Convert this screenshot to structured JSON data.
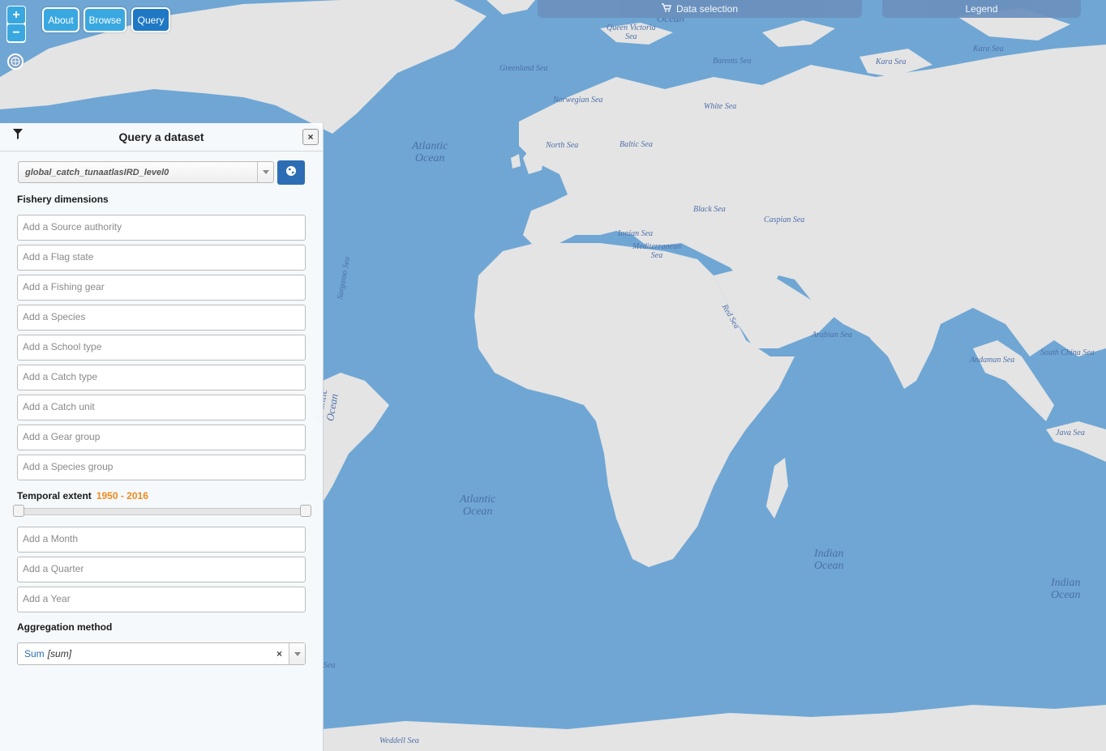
{
  "map": {
    "labels": [
      {
        "id": "ocean-top",
        "text": "Ocean"
      },
      {
        "id": "queen-victoria-sea",
        "text": "Queen Victoria\nSea"
      },
      {
        "id": "greenland-sea",
        "text": "Greenland Sea"
      },
      {
        "id": "barents-sea",
        "text": "Barents Sea"
      },
      {
        "id": "kara-sea-1",
        "text": "Kara Sea"
      },
      {
        "id": "kara-sea-2",
        "text": "Kara Sea"
      },
      {
        "id": "norwegian-sea",
        "text": "Norwegian Sea"
      },
      {
        "id": "white-sea",
        "text": "White Sea"
      },
      {
        "id": "atlantic-ocean-north",
        "text": "Atlantic\nOcean"
      },
      {
        "id": "north-sea",
        "text": "North Sea"
      },
      {
        "id": "baltic-sea",
        "text": "Baltic Sea"
      },
      {
        "id": "black-sea",
        "text": "Black Sea"
      },
      {
        "id": "caspian-sea",
        "text": "Caspian Sea"
      },
      {
        "id": "ionian-sea",
        "text": "Ionian Sea"
      },
      {
        "id": "mediterranean-sea",
        "text": "Mediterranean\nSea"
      },
      {
        "id": "sargasso-sea",
        "text": "Sargasso Sea"
      },
      {
        "id": "red-sea",
        "text": "Red Sea"
      },
      {
        "id": "arabian-sea",
        "text": "Arabian Sea"
      },
      {
        "id": "south-china-sea",
        "text": "South China Sea"
      },
      {
        "id": "andaman-sea",
        "text": "Andaman Sea"
      },
      {
        "id": "atlantic-ocean-west",
        "text": "Atlantic\nOcean"
      },
      {
        "id": "java-sea",
        "text": "Java Sea"
      },
      {
        "id": "atlantic-ocean-south",
        "text": "Atlantic\nOcean"
      },
      {
        "id": "indian-ocean-1",
        "text": "Indian\nOcean"
      },
      {
        "id": "indian-ocean-2",
        "text": "Indian\nOcean"
      },
      {
        "id": "weddell-sea",
        "text": "Weddell Sea"
      },
      {
        "id": "sea-edge",
        "text": "Sea"
      }
    ]
  },
  "controls": {
    "zoom_in": "+",
    "zoom_out": "−",
    "about": "About",
    "browse": "Browse",
    "query": "Query"
  },
  "top_tabs": {
    "data_selection": "Data selection",
    "legend": "Legend"
  },
  "panel": {
    "title": "Query a dataset",
    "close": "×",
    "dataset": "global_catch_tunaatlasIRD_level0",
    "fishery_title": "Fishery dimensions",
    "dimensions": [
      "Add a Source authority",
      "Add a Flag state",
      "Add a Fishing gear",
      "Add a Species",
      "Add a School type",
      "Add a Catch type",
      "Add a Catch unit",
      "Add a Gear group",
      "Add a Species group"
    ],
    "temporal_title": "Temporal extent",
    "temporal_range": "1950 - 2016",
    "temporal_start": 1950,
    "temporal_end": 2016,
    "temporal_dimensions": [
      "Add a Month",
      "Add a Quarter",
      "Add a Year"
    ],
    "aggregation_title": "Aggregation method",
    "aggregation_value": "Sum",
    "aggregation_code": "[sum]",
    "aggregation_clear": "×"
  },
  "colors": {
    "ocean": "#6fa6d4",
    "land": "#e4e4e4",
    "button": "#3aa8e0",
    "button_active": "#1f78c4",
    "accent": "#f08a1c"
  },
  "icons": [
    "filter-icon",
    "globe-icon",
    "caret-down-icon",
    "cart-icon",
    "graticule-icon"
  ]
}
